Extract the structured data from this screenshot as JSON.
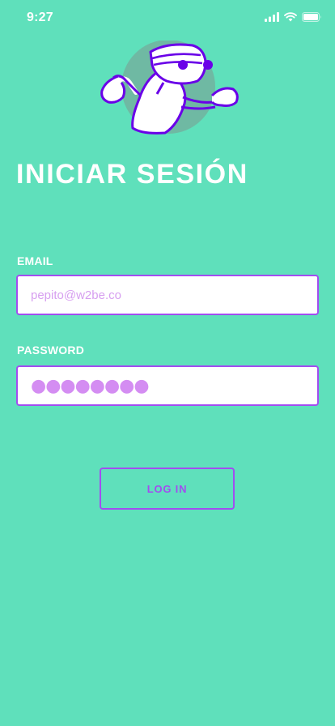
{
  "status_bar": {
    "time": "9:27"
  },
  "header": {
    "title": "INICIAR SESIÓN"
  },
  "form": {
    "email": {
      "label": "EMAIL",
      "placeholder": "pepito@w2be.co",
      "value": ""
    },
    "password": {
      "label": "PASSWORD",
      "masked_value": "●●●●●●●●"
    },
    "login_button_label": "LOG IN"
  },
  "colors": {
    "background": "#5fe0bb",
    "accent": "#a24df0",
    "placeholder": "#d79ff0",
    "mascot_circle": "#6fb9a3"
  },
  "icons": [
    "signal-icon",
    "wifi-icon",
    "battery-icon",
    "mascot-illustration"
  ]
}
